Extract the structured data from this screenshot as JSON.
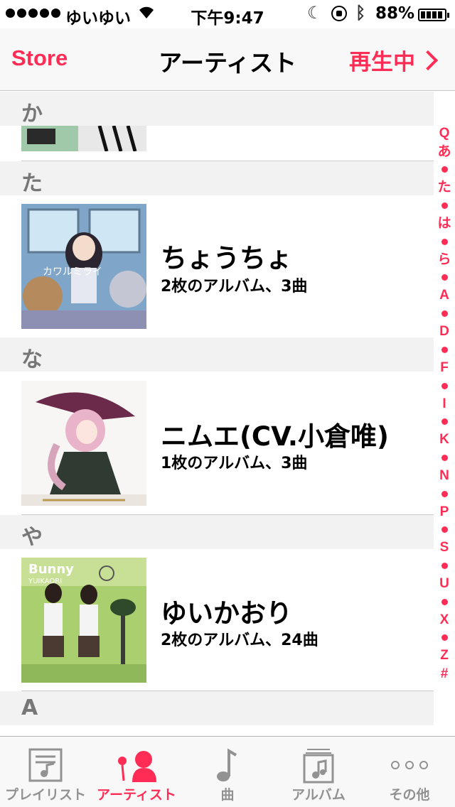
{
  "status": {
    "carrier": "ゆいゆい",
    "time": "下午9:47",
    "battery": "88%"
  },
  "nav": {
    "left": "Store",
    "title": "アーティスト",
    "right": "再生中"
  },
  "sections": [
    {
      "title": "か",
      "top": 0
    },
    {
      "title": "た"
    },
    {
      "title": "な"
    },
    {
      "title": "や"
    },
    {
      "title": "A"
    }
  ],
  "artists": [
    {
      "name": "ちょうちょ",
      "detail": "2枚のアルバム、3曲"
    },
    {
      "name": "ニムエ(CV.小倉唯)",
      "detail": "1枚のアルバム、3曲"
    },
    {
      "name": "ゆいかおり",
      "detail": "2枚のアルバム、24曲"
    }
  ],
  "index": [
    "Q",
    "あ",
    "•",
    "た",
    "•",
    "は",
    "•",
    "ら",
    "•",
    "A",
    "•",
    "D",
    "•",
    "F",
    "•",
    "I",
    "•",
    "K",
    "•",
    "N",
    "•",
    "P",
    "•",
    "S",
    "•",
    "U",
    "•",
    "X",
    "•",
    "Z",
    "#"
  ],
  "tabs": [
    {
      "label": "プレイリスト",
      "icon": "playlist-icon",
      "active": false
    },
    {
      "label": "アーティスト",
      "icon": "artist-icon",
      "active": true
    },
    {
      "label": "曲",
      "icon": "song-icon",
      "active": false
    },
    {
      "label": "アルバム",
      "icon": "album-icon",
      "active": false
    },
    {
      "label": "その他",
      "icon": "more-icon",
      "active": false
    }
  ],
  "colors": {
    "accent": "#ff2d55"
  }
}
